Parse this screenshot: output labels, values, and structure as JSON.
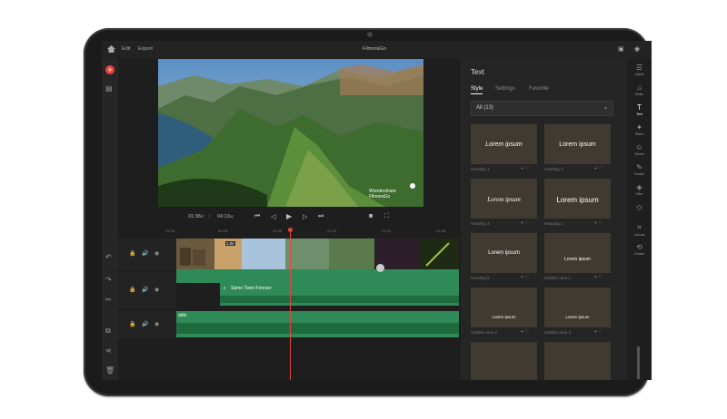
{
  "app": {
    "title": "FilmoraGo",
    "menu": [
      "Edit",
      "Export"
    ]
  },
  "preview": {
    "watermark_line1": "Wondershare",
    "watermark_line2": "FilmoraGo"
  },
  "playback": {
    "current_time": "01:38",
    "current_frac": "07",
    "total_time": "04:13",
    "total_frac": "02"
  },
  "timeline": {
    "ruler_ticks": [
      "01:16",
      "01:28",
      "01:30",
      "01:32",
      "01:34",
      "01:36"
    ],
    "clip_badge": "1.0x",
    "audio_track_1": "Same Town Forever",
    "audio_track_2": "able",
    "audio_icon": "music-note-icon"
  },
  "text_panel": {
    "title": "Text",
    "tabs": [
      "Style",
      "Settings",
      "Favorite"
    ],
    "active_tab": "Style",
    "filter_value": "All (13)",
    "items": [
      {
        "label": "Heading 1",
        "preview": "Lorem ipsum"
      },
      {
        "label": "Heading 2",
        "preview": "Lorem ipsum"
      },
      {
        "label": "Heading 3",
        "preview": "Lorem ipsum"
      },
      {
        "label": "Heading 4",
        "preview": "Lorem ipsum"
      },
      {
        "label": "Heading 5",
        "preview": "Lorem ipsum"
      },
      {
        "label": "Subtitle area 1",
        "preview": "Lorem ipsum"
      },
      {
        "label": "Subtitle area 2",
        "preview": "Lorem ipsum"
      },
      {
        "label": "Subtitle area 3",
        "preview": "Lorem ipsum"
      },
      {
        "label": "",
        "preview": ""
      },
      {
        "label": "",
        "preview": ""
      }
    ]
  },
  "side_tools": [
    {
      "label": "Adjust",
      "icon": "adjust-icon"
    },
    {
      "label": "Music",
      "icon": "music-icon"
    },
    {
      "label": "Text",
      "icon": "text-icon"
    },
    {
      "label": "Effect",
      "icon": "effect-icon"
    },
    {
      "label": "Sticker",
      "icon": "sticker-icon"
    },
    {
      "label": "Doodle",
      "icon": "doodle-icon"
    },
    {
      "label": "Filter",
      "icon": "filter-icon"
    },
    {
      "label": "",
      "icon": "transition-icon"
    },
    {
      "label": "Canvas",
      "icon": "crop-icon"
    },
    {
      "label": "Rotate",
      "icon": "rotate-icon"
    }
  ],
  "colors": {
    "accent_red": "#e8453c",
    "audio_green": "#2e8b57",
    "playhead": "#e8453c"
  }
}
